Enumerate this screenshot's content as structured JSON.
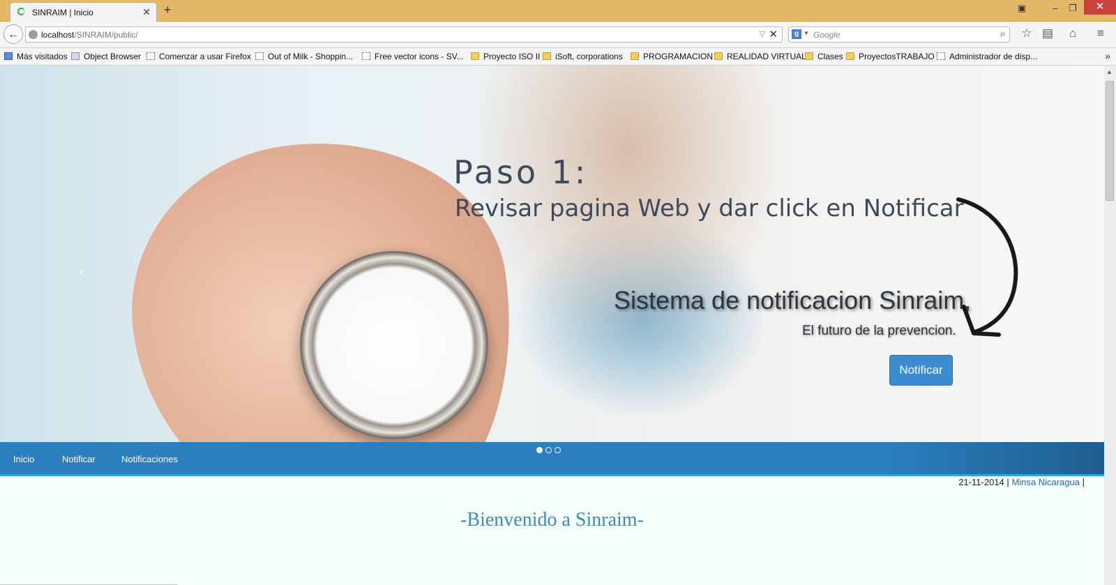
{
  "browser": {
    "tab_title": "SINRAIM | Inicio",
    "new_tab": "+",
    "url_host": "localhost",
    "url_path": "/SINRAIM/public/",
    "search_placeholder": "Google"
  },
  "bookmarks": [
    {
      "label": "Más visitados",
      "icon": "most-visited-icon"
    },
    {
      "label": "Object Browser",
      "icon": "page-icon"
    },
    {
      "label": "Comenzar a usar Firefox",
      "icon": "page-icon"
    },
    {
      "label": "Out of Milk - Shoppin...",
      "icon": "page-icon"
    },
    {
      "label": "Free vector icons - SV...",
      "icon": "page-icon"
    },
    {
      "label": "Proyecto ISO II",
      "icon": "folder-icon"
    },
    {
      "label": "iSoft, corporations",
      "icon": "folder-icon"
    },
    {
      "label": "PROGRAMACION",
      "icon": "folder-icon"
    },
    {
      "label": "REALIDAD VIRTUAL",
      "icon": "folder-icon"
    },
    {
      "label": "Clases",
      "icon": "folder-icon"
    },
    {
      "label": "ProyectosTRABAJO",
      "icon": "folder-icon"
    },
    {
      "label": "Administrador de disp...",
      "icon": "page-icon"
    }
  ],
  "carousel": {
    "step_title": "Paso  1:",
    "step_text": "Revisar pagina Web y dar click en Notificar",
    "headline": "Sistema de notificacion Sinraim,",
    "tagline": "El futuro de la prevencion.",
    "button_label": "Notificar",
    "prev": "‹",
    "next": "›",
    "slides": 3,
    "active_slide": 1
  },
  "menu": {
    "items": [
      "Inicio",
      "Notificar",
      "Notificaciones"
    ]
  },
  "info": {
    "date": "21-11-2014",
    "separator": "|",
    "link": "Minsa Nicaragua",
    "trailing": "|"
  },
  "welcome": "-Bienvenido a Sinraim-",
  "colors": {
    "tabbar": "#e3b968",
    "menubar": "#2b7fbf",
    "button": "#3c8cd2",
    "welcome": "#3a8bb8"
  }
}
